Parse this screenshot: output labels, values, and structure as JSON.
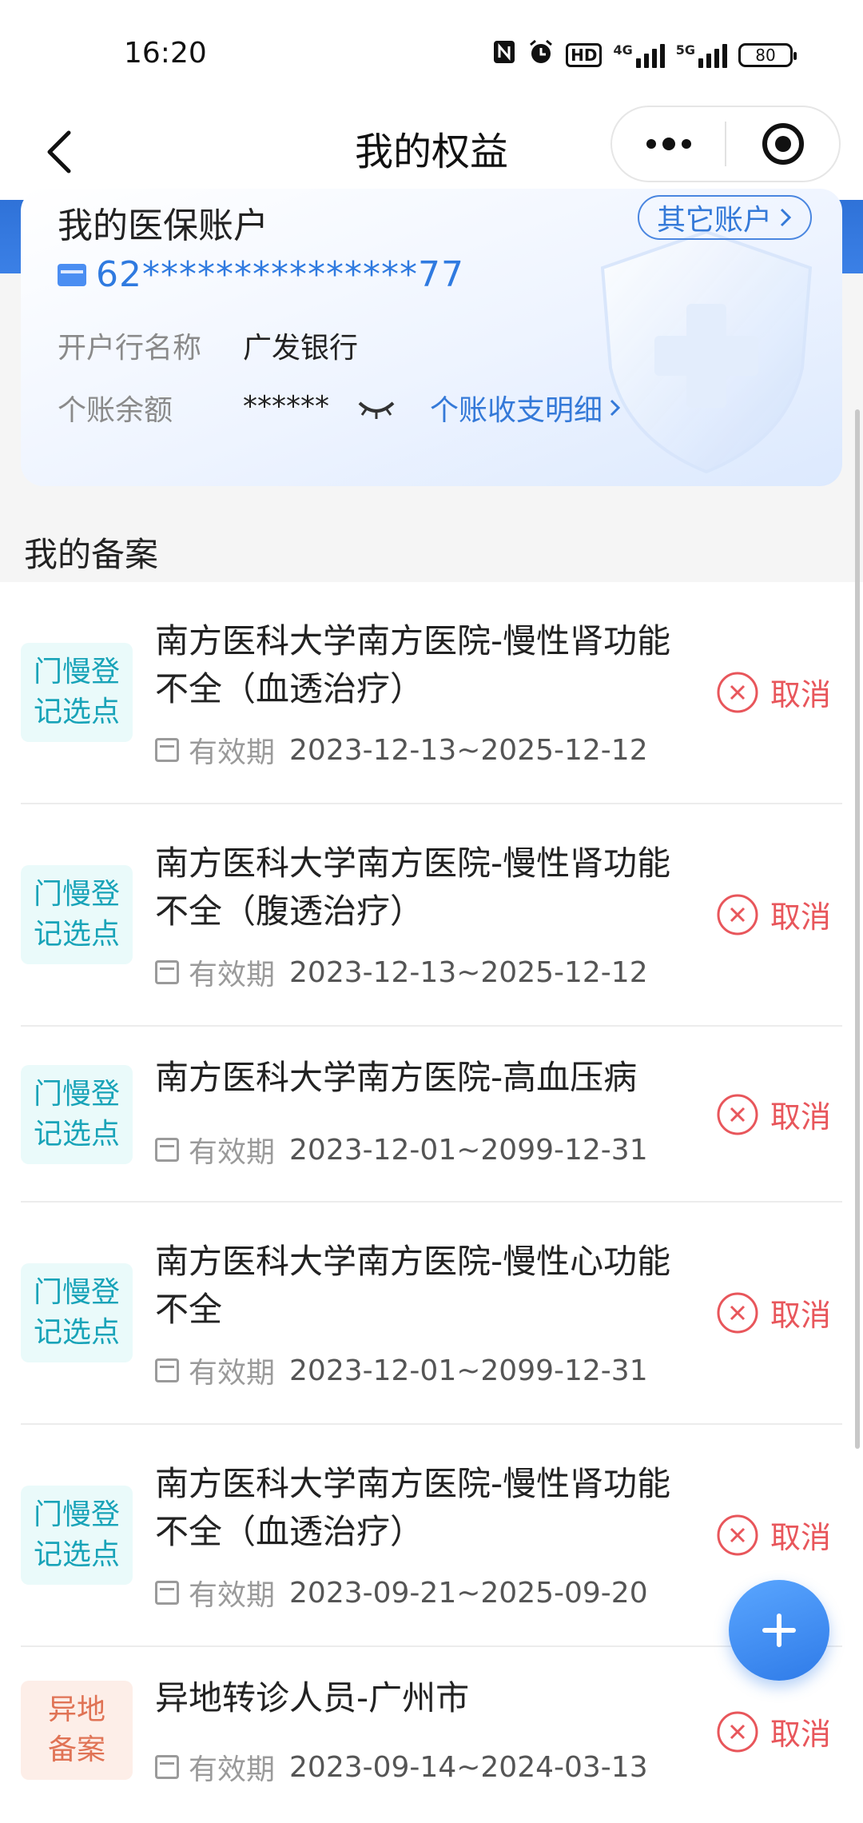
{
  "status_bar": {
    "time": "16:20",
    "icons": [
      "nfc-icon",
      "alarm-icon",
      "hd-icon",
      "signal-4g-icon",
      "signal-5g-icon",
      "battery-icon"
    ],
    "hd_label": "HD",
    "net1_label": "4G",
    "net2_label": "5G",
    "battery_level": "80"
  },
  "navbar": {
    "title": "我的权益"
  },
  "account": {
    "title": "我的医保账户",
    "other_accounts_label": "其它账户",
    "card_number": "62***************77",
    "bank_label": "开户行名称",
    "bank_value": "广发银行",
    "balance_label": "个账余额",
    "balance_value": "******",
    "detail_link": "个账收支明细"
  },
  "records": {
    "section_title": "我的备案",
    "validity_label": "有效期",
    "cancel_label": "取消",
    "items": [
      {
        "badge": "门慢登记选点",
        "badge_line1": "门慢登",
        "badge_line2": "记选点",
        "badge_color": "cyan",
        "title": "南方医科大学南方医院-慢性肾功能不全（血透治疗）",
        "validity": "2023-12-13~2025-12-12"
      },
      {
        "badge": "门慢登记选点",
        "badge_line1": "门慢登",
        "badge_line2": "记选点",
        "badge_color": "cyan",
        "title": "南方医科大学南方医院-慢性肾功能不全（腹透治疗）",
        "validity": "2023-12-13~2025-12-12"
      },
      {
        "badge": "门慢登记选点",
        "badge_line1": "门慢登",
        "badge_line2": "记选点",
        "badge_color": "cyan",
        "title": "南方医科大学南方医院-高血压病",
        "validity": "2023-12-01~2099-12-31"
      },
      {
        "badge": "门慢登记选点",
        "badge_line1": "门慢登",
        "badge_line2": "记选点",
        "badge_color": "cyan",
        "title": "南方医科大学南方医院-慢性心功能不全",
        "validity": "2023-12-01~2099-12-31"
      },
      {
        "badge": "门慢登记选点",
        "badge_line1": "门慢登",
        "badge_line2": "记选点",
        "badge_color": "cyan",
        "title": "南方医科大学南方医院-慢性肾功能不全（血透治疗）",
        "validity": "2023-09-21~2025-09-20"
      },
      {
        "badge": "异地备案",
        "badge_line1": "异地",
        "badge_line2": "备案",
        "badge_color": "orange",
        "title": "异地转诊人员-广州市",
        "validity": "2023-09-14~2024-03-13"
      }
    ]
  },
  "colors": {
    "accent_blue": "#3479d8",
    "cancel_red": "#e8565b",
    "badge_cyan": "#18a3b8",
    "badge_orange": "#e07355"
  }
}
